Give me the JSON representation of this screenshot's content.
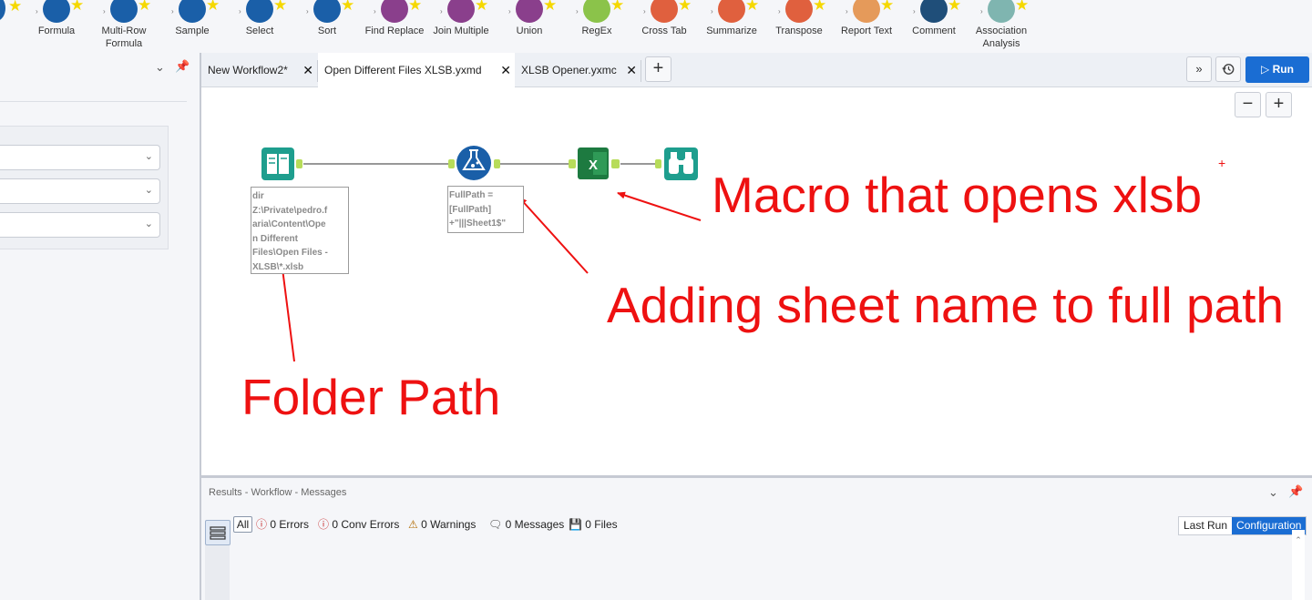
{
  "ribbon": {
    "tools": [
      {
        "label": "Formula",
        "icon": "formula-flask-icon",
        "color": "#1a5fa8"
      },
      {
        "label": "Multi-Row Formula",
        "icon": "multi-row-formula-icon",
        "color": "#1a5fa8"
      },
      {
        "label": "Sample",
        "icon": "sample-tubes-icon",
        "color": "#1a5fa8"
      },
      {
        "label": "Select",
        "icon": "select-check-icon",
        "color": "#1a5fa8"
      },
      {
        "label": "Sort",
        "icon": "sort-dots-icon",
        "color": "#1a5fa8"
      },
      {
        "label": "Find Replace",
        "icon": "find-replace-icon",
        "color": "#8a3f8c"
      },
      {
        "label": "Join Multiple",
        "icon": "join-multiple-icon",
        "color": "#8a3f8c"
      },
      {
        "label": "Union",
        "icon": "union-dna-icon",
        "color": "#8a3f8c"
      },
      {
        "label": "RegEx",
        "icon": "regex-icon",
        "color": "#8bc34a"
      },
      {
        "label": "Cross Tab",
        "icon": "cross-tab-icon",
        "color": "#e0603e"
      },
      {
        "label": "Summarize",
        "icon": "summarize-sigma-icon",
        "color": "#e0603e"
      },
      {
        "label": "Transpose",
        "icon": "transpose-icon",
        "color": "#e0603e"
      },
      {
        "label": "Report Text",
        "icon": "report-text-icon",
        "color": "#e59a5a"
      },
      {
        "label": "Comment",
        "icon": "comment-bubble-icon",
        "color": "#1f4e79"
      },
      {
        "label": "Association Analysis",
        "icon": "association-analysis-icon",
        "color": "#7fb5b0"
      }
    ]
  },
  "tabs": [
    {
      "label": "New Workflow2*",
      "active": false
    },
    {
      "label": "Open Different Files XLSB.yxmd",
      "active": true
    },
    {
      "label": "XLSB Opener.yxmc",
      "active": false
    }
  ],
  "toolbar": {
    "run_label": "Run",
    "add_tab_symbol": "+",
    "more_symbol": "»"
  },
  "canvas": {
    "zoom_out": "−",
    "zoom_in": "+",
    "nodes": {
      "directory_annotation": "dir\nZ:\\Private\\pedro.f\naria\\Content\\Ope\nn Different\nFiles\\Open Files -\nXLSB\\*.xlsb",
      "formula_annotation": "FullPath =\n[FullPath]\n+\"|||Sheet1$\""
    },
    "annotations": {
      "macro": "Macro that opens xlsb",
      "sheet": "Adding sheet name to full path",
      "folder": "Folder Path"
    }
  },
  "results": {
    "title": "Results - Workflow - Messages",
    "filters": {
      "all": "All",
      "errors": "0 Errors",
      "conv_errors": "0 Conv Errors",
      "warnings": "0 Warnings",
      "messages": "0 Messages",
      "files": "0 Files"
    },
    "last_run": "Last Run",
    "configuration": "Configuration"
  }
}
